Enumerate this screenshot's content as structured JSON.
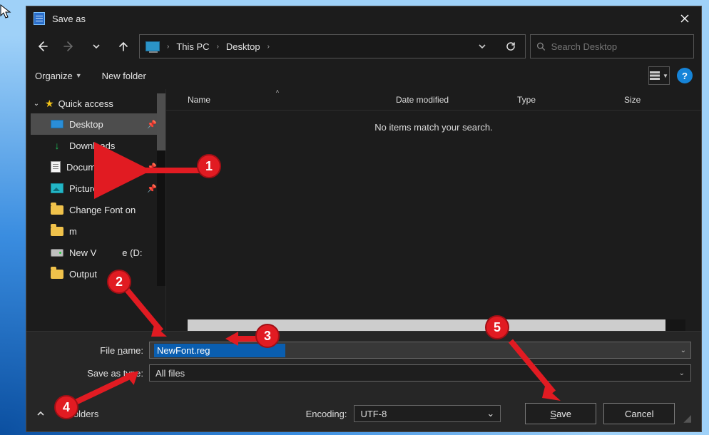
{
  "title": "Save as",
  "breadcrumb": {
    "root": "This PC",
    "leaf": "Desktop"
  },
  "search": {
    "placeholder": "Search Desktop"
  },
  "toolbar": {
    "organize": "Organize",
    "newfolder": "New folder"
  },
  "tree": {
    "quick_access": "Quick access",
    "items": [
      {
        "label": "Desktop",
        "icon": "desktop",
        "pinned": true,
        "selected": true
      },
      {
        "label": "Downloads",
        "icon": "download",
        "pinned": false
      },
      {
        "label": "Documents",
        "icon": "document",
        "pinned": true
      },
      {
        "label": "Pictures",
        "icon": "picture",
        "pinned": true
      },
      {
        "label": "Change Font on",
        "icon": "folder",
        "pinned": false
      },
      {
        "label": "m",
        "icon": "folder",
        "pinned": false
      },
      {
        "label": "New V",
        "icon": "drive",
        "pinned": false,
        "suffix": "e (D:"
      },
      {
        "label": "Output",
        "icon": "folder",
        "pinned": false
      }
    ]
  },
  "columns": {
    "name": "Name",
    "date": "Date modified",
    "type": "Type",
    "size": "Size"
  },
  "empty_msg": "No items match your search.",
  "filename": {
    "label": "File name:",
    "value": "NewFont.reg"
  },
  "filetype": {
    "label": "Save as type:",
    "value": "All files"
  },
  "encoding": {
    "label": "Encoding:",
    "value": "UTF-8"
  },
  "hide_folders": "Folders",
  "buttons": {
    "save": "Save",
    "cancel": "Cancel"
  },
  "annotations": {
    "1": "1",
    "2": "2",
    "3": "3",
    "4": "4",
    "5": "5"
  }
}
